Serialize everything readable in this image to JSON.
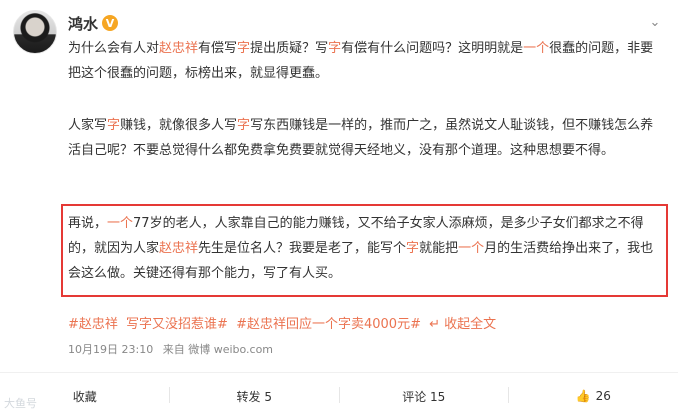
{
  "post": {
    "author": "鸿水",
    "verified_badge": "V",
    "menu_icon": "chevron-down-icon",
    "paragraph1": [
      {
        "t": "为什么会有人对"
      },
      {
        "t": "赵忠祥",
        "hl": true
      },
      {
        "t": "有偿写"
      },
      {
        "t": "字",
        "hl": true
      },
      {
        "t": "提出质疑？写"
      },
      {
        "t": "字",
        "hl": true
      },
      {
        "t": "有偿有什么问题吗？这明明就是"
      },
      {
        "t": "一个",
        "hl": true
      },
      {
        "t": "很蠢的问题，非要把这个很蠢的问题，标榜出来，就显得更蠢。"
      }
    ],
    "paragraph2": [
      {
        "t": "人家写"
      },
      {
        "t": "字",
        "hl": true
      },
      {
        "t": "赚钱，就像很多人写"
      },
      {
        "t": "字",
        "hl": true
      },
      {
        "t": "写东西赚钱是一样的，推而广之，虽然说文人耻谈钱，但不赚钱怎么养活自己呢？不要总觉得什么都免费拿免费要就觉得天经地义，没有那个道理。这种思想要不得。"
      }
    ],
    "paragraph3": [
      {
        "t": "再说，"
      },
      {
        "t": "一个",
        "hl": true
      },
      {
        "t": "77岁的老人，人家靠自己的能力赚钱，又不给子女家人添麻烦，是多少子女们都求之不得的，就因为人家"
      },
      {
        "t": "赵忠祥",
        "hl": true
      },
      {
        "t": "先生是位名人？我要是老了，能写个"
      },
      {
        "t": "字",
        "hl": true
      },
      {
        "t": "就能把"
      },
      {
        "t": "一个",
        "hl": true
      },
      {
        "t": "月的生活费给挣出来了，我也会这么做。关键还得有那个能力，写了有人买。"
      }
    ],
    "tags": [
      "#赵忠祥",
      "写字又没招惹谁#",
      "#赵忠祥回应一个字卖4000元#"
    ],
    "collapse_label": "收起全文",
    "meta": {
      "time": "10月19日 23:10",
      "source": "来自 微博 weibo.com"
    }
  },
  "actions": [
    {
      "label": "收藏",
      "icon": "favorite-icon"
    },
    {
      "label": "转发 5",
      "icon": "repost-icon"
    },
    {
      "label": "评论 15",
      "icon": "comment-icon"
    },
    {
      "label": "26",
      "icon": "like-icon"
    }
  ],
  "watermark": "大鱼号"
}
